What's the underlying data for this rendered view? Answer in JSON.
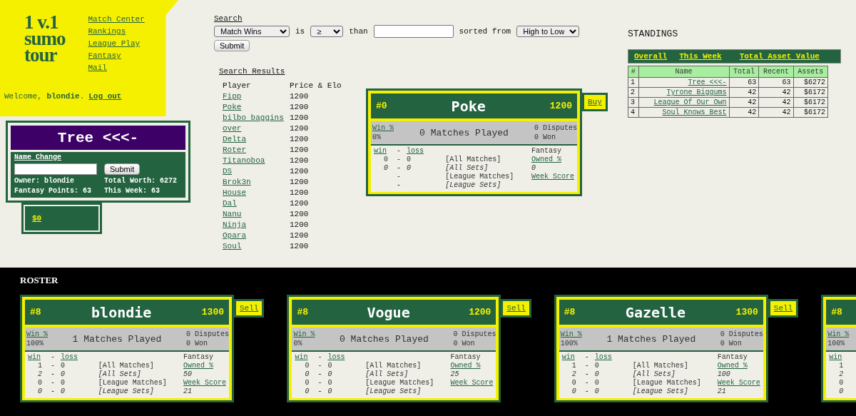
{
  "header": {
    "logo": [
      "1 v.1",
      "sumo",
      "tour"
    ],
    "nav": [
      "Match Center",
      "Rankings",
      "League Play",
      "Fantasy",
      "Mail"
    ],
    "welcome": "Welcome, **blondie**.",
    "logout": "Log out"
  },
  "team": {
    "name": "Tree <<<-",
    "name_change": "Name Change",
    "submit": "Submit",
    "owner": "Owner: blondie",
    "worth": "Total Worth: 6272",
    "points": "Fantasy Points: 63",
    "week": "This Week: 63",
    "cash": "$0"
  },
  "search": {
    "title": "Search",
    "field": "Match Wins",
    "is": "is",
    "op": "≥",
    "than": "than",
    "sorted": "sorted from",
    "order": "High to Low",
    "submit": "Submit"
  },
  "results": {
    "title": "Search Results",
    "columns": [
      "Player",
      "Price & Elo"
    ],
    "rows": [
      {
        "player": "Fipp",
        "price": "1200"
      },
      {
        "player": "Poke",
        "price": "1200"
      },
      {
        "player": "bilbo baggins",
        "price": "1200"
      },
      {
        "player": "over",
        "price": "1200"
      },
      {
        "player": "Delta",
        "price": "1200"
      },
      {
        "player": "Roter",
        "price": "1200"
      },
      {
        "player": "Titanoboa",
        "price": "1200"
      },
      {
        "player": "DS",
        "price": "1200"
      },
      {
        "player": "Brok3n",
        "price": "1200"
      },
      {
        "player": "House",
        "price": "1200"
      },
      {
        "player": "Dal",
        "price": "1200"
      },
      {
        "player": "Nanu",
        "price": "1200"
      },
      {
        "player": "Ninja",
        "price": "1200"
      },
      {
        "player": "Opara",
        "price": "1200"
      },
      {
        "player": "Soul",
        "price": "1200"
      }
    ]
  },
  "selected_player": {
    "number": "#0",
    "name": "Poke",
    "price": "1200",
    "action": "Buy",
    "win_label": "Win %",
    "win_pct": "0%",
    "matches": "0 Matches Played",
    "disputes": "0 Disputes",
    "won": "0 Won",
    "wl": {
      "win": "win",
      "sep": "-",
      "loss": "loss"
    },
    "records": [
      {
        "kind": "matches",
        "win": "0",
        "sep": "-",
        "loss": "0",
        "label": "[All Matches]"
      },
      {
        "kind": "sets",
        "win": "0",
        "sep": "-",
        "loss": "0",
        "label": "[All Sets]"
      },
      {
        "kind": "matches",
        "sep": "-",
        "label": "[League Matches]"
      },
      {
        "kind": "sets",
        "sep": "-",
        "label": "[League Sets]"
      }
    ],
    "fantasy": "Fantasy",
    "owned_label": "Owned %",
    "owned": "0",
    "week_label": "Week Score"
  },
  "standings": {
    "title": "STANDINGS",
    "tabs": [
      "Overall",
      "This Week",
      "Total Asset Value"
    ],
    "columns": [
      "#",
      "Name",
      "Total",
      "Recent",
      "Assets"
    ],
    "rows": [
      {
        "rank": "1",
        "name": "Tree <<<-",
        "total": "63",
        "recent": "63",
        "assets": "$6272"
      },
      {
        "rank": "2",
        "name": "Tyrone Biggums",
        "total": "42",
        "recent": "42",
        "assets": "$6172"
      },
      {
        "rank": "3",
        "name": "League Of Our Own",
        "total": "42",
        "recent": "42",
        "assets": "$6172"
      },
      {
        "rank": "4",
        "name": "Soul Knows Best",
        "total": "42",
        "recent": "42",
        "assets": "$6172"
      }
    ]
  },
  "roster": {
    "title": "ROSTER",
    "players": [
      {
        "number": "#8",
        "name": "blondie",
        "price": "1300",
        "action": "Sell",
        "win_label": "Win %",
        "win_pct": "100%",
        "matches": "1 Matches Played",
        "disputes": "0 Disputes",
        "won": "0 Won",
        "wl": {
          "win": "win",
          "sep": "-",
          "loss": "loss"
        },
        "records": [
          {
            "kind": "matches",
            "win": "1",
            "sep": "-",
            "loss": "0",
            "label": "[All Matches]"
          },
          {
            "kind": "sets",
            "win": "2",
            "sep": "-",
            "loss": "0",
            "label": "[All Sets]"
          },
          {
            "kind": "matches",
            "win": "0",
            "sep": "-",
            "loss": "0",
            "label": "[League Matches]"
          },
          {
            "kind": "sets",
            "win": "0",
            "sep": "-",
            "loss": "0",
            "label": "[League Sets]"
          }
        ],
        "fantasy": "Fantasy",
        "owned_label": "Owned %",
        "owned": "50",
        "week_label": "Week Score",
        "week_score": "21"
      },
      {
        "number": "#8",
        "name": "Vogue",
        "price": "1200",
        "action": "Sell",
        "win_label": "Win %",
        "win_pct": "0%",
        "matches": "0 Matches Played",
        "disputes": "0 Disputes",
        "won": "0 Won",
        "wl": {
          "win": "win",
          "sep": "-",
          "loss": "loss"
        },
        "records": [
          {
            "kind": "matches",
            "win": "0",
            "sep": "-",
            "loss": "0",
            "label": "[All Matches]"
          },
          {
            "kind": "sets",
            "win": "0",
            "sep": "-",
            "loss": "0",
            "label": "[All Sets]"
          },
          {
            "kind": "matches",
            "win": "0",
            "sep": "-",
            "loss": "0",
            "label": "[League Matches]"
          },
          {
            "kind": "sets",
            "win": "0",
            "sep": "-",
            "loss": "0",
            "label": "[League Sets]"
          }
        ],
        "fantasy": "Fantasy",
        "owned_label": "Owned %",
        "owned": "25",
        "week_label": "Week Score"
      },
      {
        "number": "#8",
        "name": "Gazelle",
        "price": "1300",
        "action": "Sell",
        "win_label": "Win %",
        "win_pct": "100%",
        "matches": "1 Matches Played",
        "disputes": "0 Disputes",
        "won": "0 Won",
        "wl": {
          "win": "win",
          "sep": "-",
          "loss": "loss"
        },
        "records": [
          {
            "kind": "matches",
            "win": "1",
            "sep": "-",
            "loss": "0",
            "label": "[All Matches]"
          },
          {
            "kind": "sets",
            "win": "2",
            "sep": "-",
            "loss": "0",
            "label": "[All Sets]"
          },
          {
            "kind": "matches",
            "win": "0",
            "sep": "-",
            "loss": "0",
            "label": "[League Matches]"
          },
          {
            "kind": "sets",
            "win": "0",
            "sep": "-",
            "loss": "0",
            "label": "[League Sets]"
          }
        ],
        "fantasy": "Fantasy",
        "owned_label": "Owned %",
        "owned": "100",
        "week_label": "Week Score",
        "week_score": "21"
      },
      {
        "number": "#8",
        "win_label": "Win %",
        "win_pct": "100%",
        "wl": {
          "win": "win"
        },
        "records": [
          {
            "kind": "matches",
            "win": "1"
          },
          {
            "kind": "sets",
            "win": "2"
          },
          {
            "kind": "matches",
            "win": "0"
          },
          {
            "kind": "sets",
            "win": "0"
          }
        ]
      }
    ]
  }
}
